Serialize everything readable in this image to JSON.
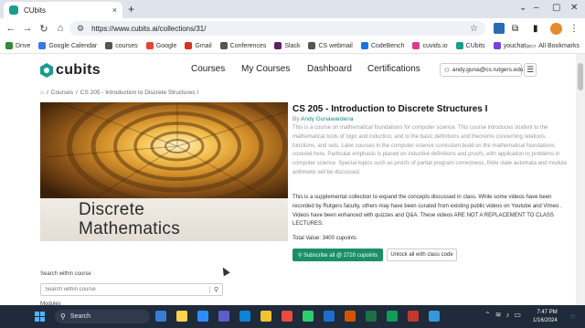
{
  "browser": {
    "tab_title": "CUbits",
    "tab_close": "×",
    "new_tab": "+",
    "url": "https://www.cubits.ai/collections/31/",
    "window_controls": [
      "–",
      "▢",
      "✕"
    ],
    "bookmarks": [
      {
        "label": "Drive",
        "color": "#2f8a3a"
      },
      {
        "label": "Google Calendar",
        "color": "#3b78e7"
      },
      {
        "label": "courses",
        "color": "#555555"
      },
      {
        "label": "Google",
        "color": "#ea4335"
      },
      {
        "label": "Gmail",
        "color": "#d93025"
      },
      {
        "label": "Conferences",
        "color": "#555555"
      },
      {
        "label": "Slack",
        "color": "#611f69"
      },
      {
        "label": "CS webmail",
        "color": "#555555"
      },
      {
        "label": "CodeBench",
        "color": "#1a73e8"
      },
      {
        "label": "cuvids.io",
        "color": "#d93c8c"
      },
      {
        "label": "CUbits",
        "color": "#1a9d8e"
      },
      {
        "label": "youchat",
        "color": "#7b3fe4"
      }
    ],
    "bookmarks_more": "»",
    "all_bookmarks": "All Bookmarks"
  },
  "site": {
    "logo": "cubits",
    "nav": [
      "Courses",
      "My Courses",
      "Dashboard",
      "Certifications"
    ],
    "user_email": "andy.guna@cs.rutgers.edu",
    "menu_icon": "☰"
  },
  "breadcrumb": {
    "home_icon": "⌂",
    "courses": "Courses",
    "current": "CS 205 - Introduction to Discrete Structures I"
  },
  "cover": {
    "line1": "Discrete",
    "line2": "Mathematics"
  },
  "course": {
    "title": "CS 205 - Introduction to Discrete Structures I",
    "by": "By",
    "author": "Andy Gunawardena",
    "description": "This is a course on mathematical foundations for computer science. This course introduces student to the mathematical tools of logic and induction, and to the basic definitions and theorems concerning relations, functions, and sets. Later courses in the computer science curriculum build on the mathematical foundations covered here. Particular emphasis is placed on inductive definitions and proofs, with application to problems in computer science. Special topics such as proofs of partial program correctness, finite state automata and modula arithmetic will be discussed.",
    "supplement": "This is a supplemental collection to expand the concepts discussed in class. While some videos have been recorded by Rutgers faculty, others may have been curated from existing public videos on Youtube and Vimeo . Videos have been enhanced with quizzes and Q&A. These videos ARE NOT A REPLACEMENT TO CLASS LECTURES.",
    "total_value": "Total Value: 3400 cupoints",
    "subscribe_label": "⚲ Subscribe all @ 2720 cupoints",
    "unlock_label": "Unlock all with class code"
  },
  "search": {
    "label": "Search within course",
    "placeholder": "Search within course"
  },
  "modules_label": "Modules",
  "taskbar": {
    "search_placeholder": "Search",
    "apps": [
      "#3a7bd5",
      "#ffd24d",
      "#2d8cff",
      "#5b5fc7",
      "#0a84d6",
      "#f1c232",
      "#e74c3c",
      "#2ecc71",
      "#1d6fce",
      "#d35400",
      "#1e7145",
      "#0f9d58",
      "#c0392b",
      "#3498db"
    ],
    "time": "7:47 PM",
    "date": "1/16/2024"
  }
}
